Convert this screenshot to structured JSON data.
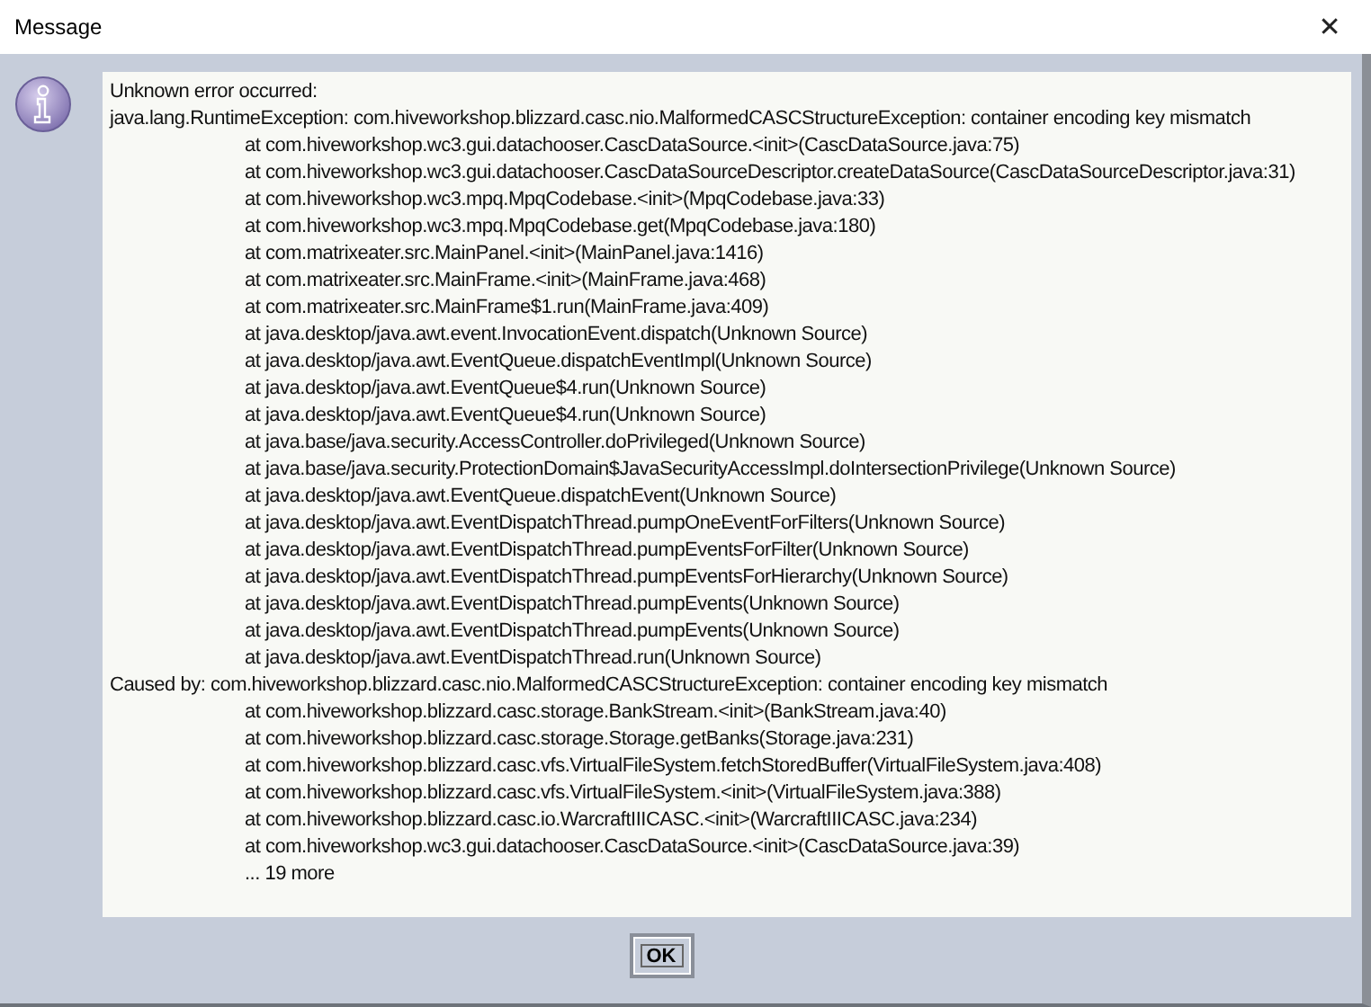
{
  "window": {
    "title": "Message",
    "close": "✕"
  },
  "message": {
    "lines": [
      {
        "kind": "plain",
        "text": "Unknown error occurred:"
      },
      {
        "kind": "plain",
        "text": "java.lang.RuntimeException: com.hiveworkshop.blizzard.casc.nio.MalformedCASCStructureException: container encoding key mismatch"
      },
      {
        "kind": "frame",
        "text": "at com.hiveworkshop.wc3.gui.datachooser.CascDataSource.<init>(CascDataSource.java:75)"
      },
      {
        "kind": "frame",
        "text": "at com.hiveworkshop.wc3.gui.datachooser.CascDataSourceDescriptor.createDataSource(CascDataSourceDescriptor.java:31)"
      },
      {
        "kind": "frame",
        "text": "at com.hiveworkshop.wc3.mpq.MpqCodebase.<init>(MpqCodebase.java:33)"
      },
      {
        "kind": "frame",
        "text": "at com.hiveworkshop.wc3.mpq.MpqCodebase.get(MpqCodebase.java:180)"
      },
      {
        "kind": "frame",
        "text": "at com.matrixeater.src.MainPanel.<init>(MainPanel.java:1416)"
      },
      {
        "kind": "frame",
        "text": "at com.matrixeater.src.MainFrame.<init>(MainFrame.java:468)"
      },
      {
        "kind": "frame",
        "text": "at com.matrixeater.src.MainFrame$1.run(MainFrame.java:409)"
      },
      {
        "kind": "frame",
        "text": "at java.desktop/java.awt.event.InvocationEvent.dispatch(Unknown Source)"
      },
      {
        "kind": "frame",
        "text": "at java.desktop/java.awt.EventQueue.dispatchEventImpl(Unknown Source)"
      },
      {
        "kind": "frame",
        "text": "at java.desktop/java.awt.EventQueue$4.run(Unknown Source)"
      },
      {
        "kind": "frame",
        "text": "at java.desktop/java.awt.EventQueue$4.run(Unknown Source)"
      },
      {
        "kind": "frame",
        "text": "at java.base/java.security.AccessController.doPrivileged(Unknown Source)"
      },
      {
        "kind": "frame",
        "text": "at java.base/java.security.ProtectionDomain$JavaSecurityAccessImpl.doIntersectionPrivilege(Unknown Source)"
      },
      {
        "kind": "frame",
        "text": "at java.desktop/java.awt.EventQueue.dispatchEvent(Unknown Source)"
      },
      {
        "kind": "frame",
        "text": "at java.desktop/java.awt.EventDispatchThread.pumpOneEventForFilters(Unknown Source)"
      },
      {
        "kind": "frame",
        "text": "at java.desktop/java.awt.EventDispatchThread.pumpEventsForFilter(Unknown Source)"
      },
      {
        "kind": "frame",
        "text": "at java.desktop/java.awt.EventDispatchThread.pumpEventsForHierarchy(Unknown Source)"
      },
      {
        "kind": "frame",
        "text": "at java.desktop/java.awt.EventDispatchThread.pumpEvents(Unknown Source)"
      },
      {
        "kind": "frame",
        "text": "at java.desktop/java.awt.EventDispatchThread.pumpEvents(Unknown Source)"
      },
      {
        "kind": "frame",
        "text": "at java.desktop/java.awt.EventDispatchThread.run(Unknown Source)"
      },
      {
        "kind": "plain",
        "text": "Caused by: com.hiveworkshop.blizzard.casc.nio.MalformedCASCStructureException: container encoding key mismatch"
      },
      {
        "kind": "frame",
        "text": "at com.hiveworkshop.blizzard.casc.storage.BankStream.<init>(BankStream.java:40)"
      },
      {
        "kind": "frame",
        "text": "at com.hiveworkshop.blizzard.casc.storage.Storage.getBanks(Storage.java:231)"
      },
      {
        "kind": "frame",
        "text": "at com.hiveworkshop.blizzard.casc.vfs.VirtualFileSystem.fetchStoredBuffer(VirtualFileSystem.java:408)"
      },
      {
        "kind": "frame",
        "text": "at com.hiveworkshop.blizzard.casc.vfs.VirtualFileSystem.<init>(VirtualFileSystem.java:388)"
      },
      {
        "kind": "frame",
        "text": "at com.hiveworkshop.blizzard.casc.io.WarcraftIIICASC.<init>(WarcraftIIICASC.java:234)"
      },
      {
        "kind": "frame",
        "text": "at com.hiveworkshop.wc3.gui.datachooser.CascDataSource.<init>(CascDataSource.java:39)"
      },
      {
        "kind": "frame",
        "text": "... 19 more"
      }
    ]
  },
  "buttons": [
    {
      "label": "OK",
      "focused": true
    }
  ]
}
